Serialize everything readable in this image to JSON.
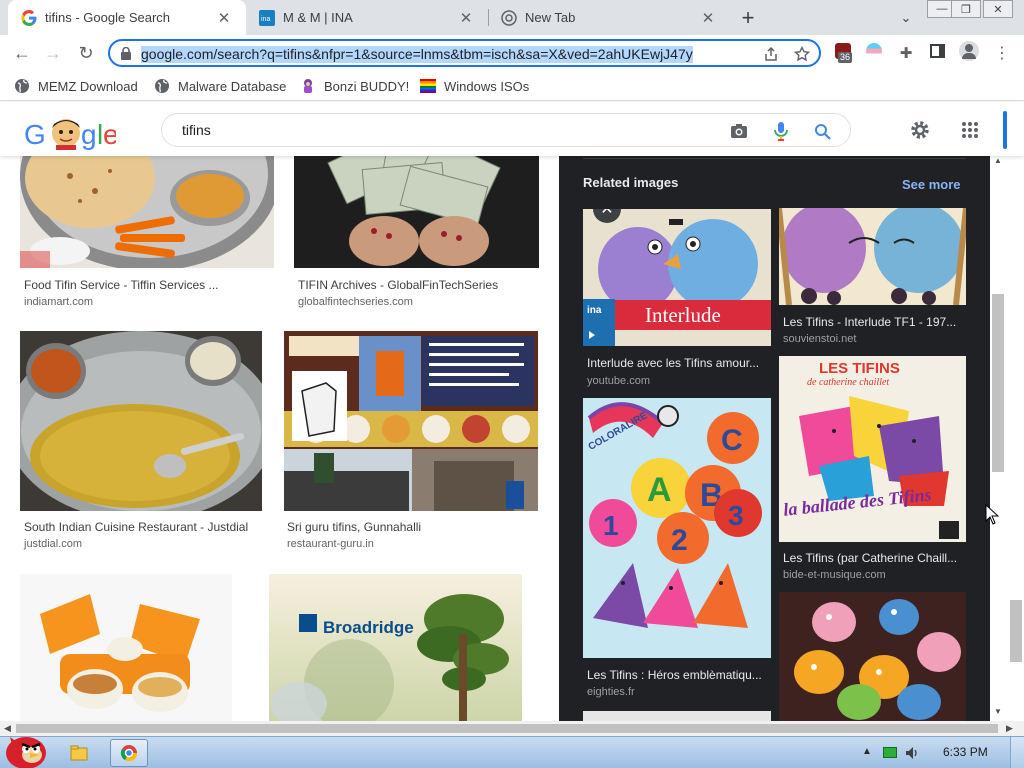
{
  "tabs": [
    {
      "title": "tifins - Google Search",
      "active": true,
      "favicon": "google-g-icon"
    },
    {
      "title": "M & M | INA",
      "active": false,
      "favicon": "ina-icon"
    },
    {
      "title": "New Tab",
      "active": false,
      "favicon": "chrome-icon"
    }
  ],
  "toolbar": {
    "url": "google.com/search?q=tifins&nfpr=1&source=lnms&tbm=isch&sa=X&ved=2ahUKEwjJ47y",
    "extension_badge": "36"
  },
  "bookmarks": [
    {
      "label": "MEMZ Download",
      "icon": "globe-icon"
    },
    {
      "label": "Malware Database",
      "icon": "globe-icon"
    },
    {
      "label": "Bonzi BUDDY!",
      "icon": "bonzi-icon"
    },
    {
      "label": "Windows ISOs",
      "icon": "windows-flag-icon"
    }
  ],
  "search": {
    "query": "tifins"
  },
  "results": [
    {
      "title": "Food Tifin Service - Tiffin Services ...",
      "source": "indiamart.com"
    },
    {
      "title": "TIFIN Archives - GlobalFinTechSeries",
      "source": "globalfintechseries.com"
    },
    {
      "title": "South Indian Cuisine Restaurant - Justdial",
      "source": "justdial.com"
    },
    {
      "title": "Sri guru tifins, Gunnahalli",
      "source": "restaurant-guru.in"
    },
    {
      "title": "",
      "source": ""
    },
    {
      "title": "",
      "source": ""
    }
  ],
  "panel": {
    "related_label": "Related images",
    "see_more": "See more",
    "items": [
      {
        "title": "Interlude avec les Tifins amour...",
        "source": "youtube.com"
      },
      {
        "title": "Les Tifins - Interlude TF1 - 197...",
        "source": "souvienstoi.net"
      },
      {
        "title": "Les Tifins : Héros emblèmatiqu...",
        "source": "eighties.fr"
      },
      {
        "title": "Les Tifins (par Catherine Chaill...",
        "source": "bide-et-musique.com"
      }
    ],
    "image_texts": {
      "interlude": "Interlude",
      "ina_badge": "ina",
      "coloralire": "COLORALIRE",
      "les_tifins": "LES TIFINS",
      "catherine": "de catherine chaillet",
      "ballade": "la ballade des Tifins",
      "broadridge": "Broadridge"
    }
  },
  "taskbar": {
    "time": "6:33 PM"
  }
}
